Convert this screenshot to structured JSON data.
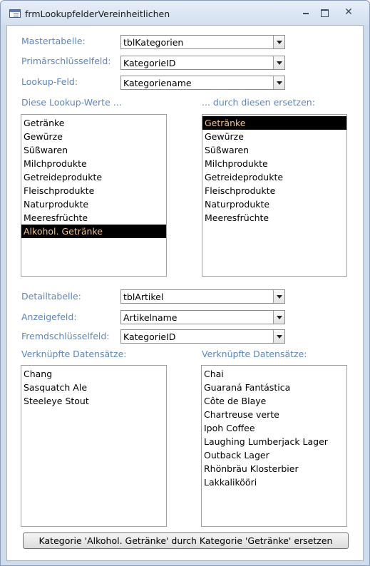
{
  "window": {
    "title": "frmLookupfelderVereinheitlichen",
    "close_glyph": "✕"
  },
  "master": {
    "table_label": "Mastertabelle:",
    "table_value": "tblKategorien",
    "pk_label": "Primärschlüsselfeld:",
    "pk_value": "KategorieID",
    "lookup_label": "Lookup-Feld:",
    "lookup_value": "Kategoriename"
  },
  "lists": {
    "source_label": "Diese Lookup-Werte ...",
    "target_label": "... durch diesen ersetzen:",
    "source_items": [
      "Getränke",
      "Gewürze",
      "Süßwaren",
      "Milchprodukte",
      "Getreideprodukte",
      "Fleischprodukte",
      "Naturprodukte",
      "Meeresfrüchte",
      "Alkohol. Getränke"
    ],
    "source_selected": 8,
    "target_items": [
      "Getränke",
      "Gewürze",
      "Süßwaren",
      "Milchprodukte",
      "Getreideprodukte",
      "Fleischprodukte",
      "Naturprodukte",
      "Meeresfrüchte"
    ],
    "target_selected": 0
  },
  "detail": {
    "table_label": "Detailtabelle:",
    "table_value": "tblArtikel",
    "display_label": "Anzeigefeld:",
    "display_value": "Artikelname",
    "fk_label": "Fremdschlüsselfeld:",
    "fk_value": "KategorieID"
  },
  "records": {
    "left_label": "Verknüpfte Datensätze:",
    "right_label": "Verknüpfte Datensätze:",
    "left_items": [
      "Chang",
      "Sasquatch Ale",
      "Steeleye Stout"
    ],
    "right_items": [
      "Chai",
      "Guaraná Fantástica",
      "Côte de Blaye",
      "Chartreuse verte",
      "Ipoh Coffee",
      "Laughing Lumberjack Lager",
      "Outback Lager",
      "Rhönbräu Klosterbier",
      "Lakkalikööri"
    ]
  },
  "action": {
    "replace_label": "Kategorie 'Alkohol. Getränke' durch Kategorie 'Getränke' ersetzen"
  },
  "colors": {
    "label": "#5b86c0",
    "selection_bg": "#000000",
    "selection_text": "#f2c58a"
  }
}
